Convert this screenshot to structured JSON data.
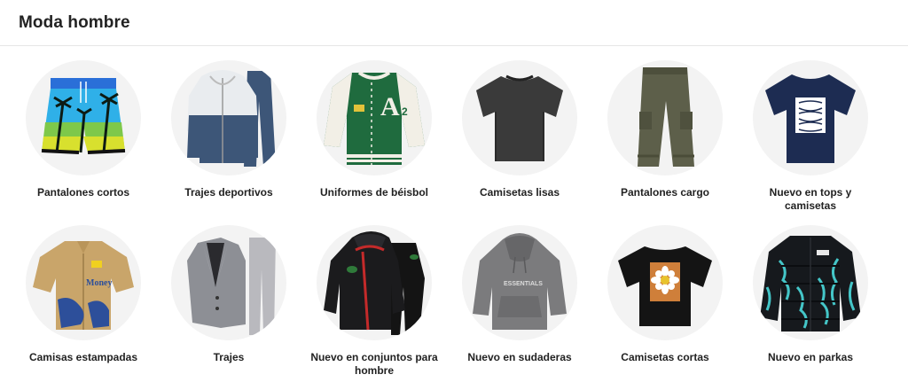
{
  "section": {
    "title": "Moda hombre"
  },
  "categories": [
    {
      "label": "Pantalones cortos",
      "icon": "shorts-image"
    },
    {
      "label": "Trajes deportivos",
      "icon": "tracksuit-image"
    },
    {
      "label": "Uniformes de béisbol",
      "icon": "varsity-jacket-image"
    },
    {
      "label": "Camisetas lisas",
      "icon": "plain-tshirt-image"
    },
    {
      "label": "Pantalones cargo",
      "icon": "cargo-pants-image"
    },
    {
      "label": "Nuevo en tops y camisetas",
      "icon": "graphic-tshirt-image"
    },
    {
      "label": "Camisas estampadas",
      "icon": "printed-shirt-image"
    },
    {
      "label": "Trajes",
      "icon": "suit-image"
    },
    {
      "label": "Nuevo en conjuntos para hombre",
      "icon": "hoodie-set-image"
    },
    {
      "label": "Nuevo en sudaderas",
      "icon": "hoodie-image"
    },
    {
      "label": "Camisetas cortas",
      "icon": "short-tshirt-image"
    },
    {
      "label": "Nuevo en parkas",
      "icon": "parka-image"
    }
  ]
}
